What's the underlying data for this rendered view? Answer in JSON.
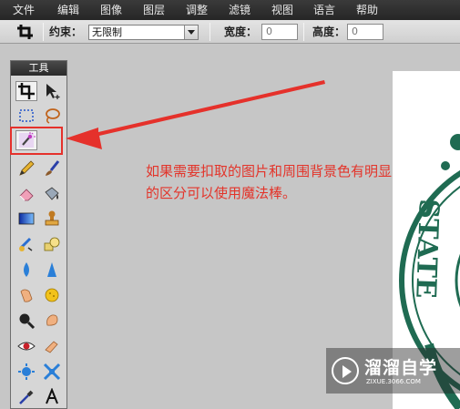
{
  "menu": [
    "文件",
    "编辑",
    "图像",
    "图层",
    "调整",
    "滤镜",
    "视图",
    "语言",
    "帮助"
  ],
  "options_bar": {
    "constraint_label": "约束：",
    "constraint_value": "无限制",
    "width_label": "宽度：",
    "width_value": "0",
    "height_label": "高度：",
    "height_value": "0"
  },
  "tools_panel": {
    "title": "工具",
    "tools": [
      "crop-icon",
      "move-icon",
      "marquee-icon",
      "lasso-icon",
      "magic-wand-icon",
      "pencil-icon",
      "brush-icon",
      "eraser-icon",
      "paint-bucket-icon",
      "gradient-icon",
      "stamp-icon",
      "color-replace-icon",
      "shape-icon",
      "blur-icon",
      "sharpen-icon",
      "smudge-icon",
      "sponge-icon",
      "zoom-icon",
      "dodge-icon",
      "red-eye-icon",
      "burn-icon",
      "bloat-icon",
      "pinch-icon",
      "eyedropper-icon",
      "text-icon"
    ]
  },
  "annotation": {
    "line1": "如果需要扣取的图片和周围背景色有明显",
    "line2": "的区分可以使用魔法棒。",
    "color": "#e3342a"
  },
  "watermark": {
    "brand": "溜溜自学",
    "url": "ZIXUE.3066.COM"
  },
  "canvas_image": {
    "text": "STATE"
  }
}
